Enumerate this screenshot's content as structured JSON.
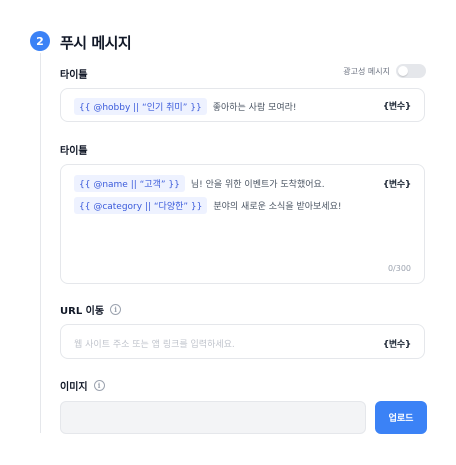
{
  "section": {
    "step_number": "2",
    "title": "푸시 메시지"
  },
  "title_field": {
    "label": "타이틀",
    "ad_toggle_label": "광고성 메시지",
    "ad_toggle_on": false,
    "chip": "{{ @hobby || “인기 취미” }}",
    "text": "좋아하는 사람 모여라!",
    "variable_button": "{변수}"
  },
  "body_field": {
    "label": "타이틀",
    "line1_chip": "{{ @name || “고객” }}",
    "line1_text": "님! 안을 위한 이벤트가 도착했어요.",
    "line2_chip": "{{ @category || “다양한” }}",
    "line2_text": "분야의 새로운 소식을 받아보세요!",
    "variable_button": "{변수}",
    "counter": "0/300"
  },
  "url_field": {
    "label": "URL 이동",
    "info_icon": "info-icon",
    "placeholder": "웹 사이트 주소 또는 앱 링크를 입력하세요.",
    "variable_button": "{변수}"
  },
  "image_field": {
    "label": "이미지",
    "info_icon": "info-icon",
    "upload_button": "업로드"
  },
  "colors": {
    "accent": "#3b82f6",
    "chip_bg": "#eef2ff",
    "chip_text": "#3b5bdb"
  }
}
